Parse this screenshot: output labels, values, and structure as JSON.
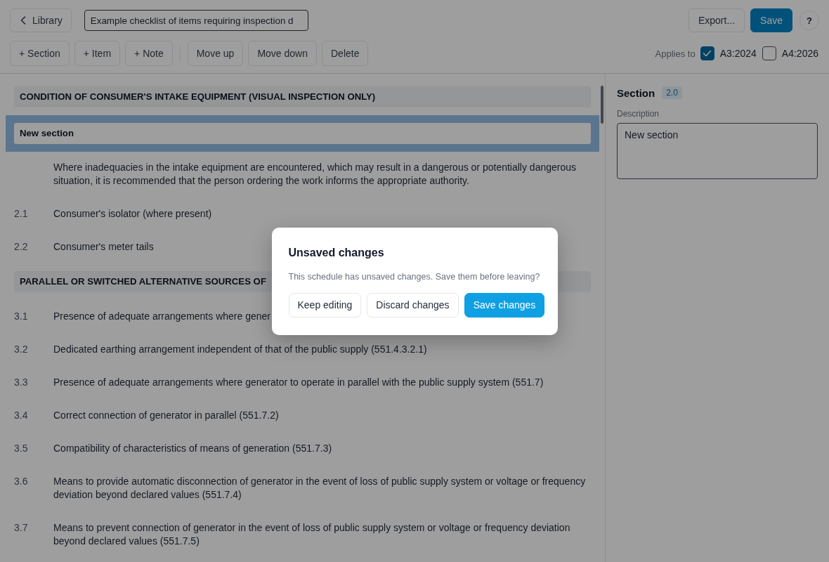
{
  "header": {
    "back_button": "Library",
    "title_field": {
      "value": "Example checklist of items requiring inspection d"
    },
    "export_button": "Export...",
    "save_button": "Save",
    "help_button": "?"
  },
  "toolbar": {
    "insert_buttons": [
      "+ Section",
      "+ Item",
      "+ Note"
    ],
    "edit_buttons": [
      "Move up",
      "Move down",
      "Delete"
    ]
  },
  "applies_to": {
    "label": "Applies to",
    "options": [
      {
        "label": "A3:2024",
        "checked": true
      },
      {
        "label": "A4:2026",
        "checked": false
      }
    ]
  },
  "checklist": {
    "rows": [
      {
        "kind": "heading",
        "text": "CONDITION OF CONSUMER'S INTAKE EQUIPMENT (VISUAL INSPECTION ONLY)",
        "selected": false
      },
      {
        "kind": "heading",
        "text": "New section",
        "selected": true
      },
      {
        "kind": "note",
        "text": "Where inadequacies in the intake equipment are encountered, which may result in a dangerous or potentially dangerous situation, it is recommended that the person ordering the work informs the appropriate authority.",
        "selected": false
      },
      {
        "kind": "item",
        "number": "2.1",
        "text": "Consumer's isolator (where present)",
        "selected": false
      },
      {
        "kind": "item",
        "number": "2.2",
        "text": "Consumer's meter tails",
        "selected": false
      },
      {
        "kind": "heading",
        "text": "PARALLEL OR SWITCHED ALTERNATIVE SOURCES OF",
        "selected": false
      },
      {
        "kind": "item",
        "number": "3.1",
        "text": "Presence of adequate arrangements where gener",
        "selected": false
      },
      {
        "kind": "item",
        "number": "3.2",
        "text": "Dedicated earthing arrangement independent of that of the public supply (551.4.3.2.1)",
        "selected": false
      },
      {
        "kind": "item",
        "number": "3.3",
        "text": "Presence of adequate arrangements where generator to operate in parallel with the public supply system (551.7)",
        "selected": false
      },
      {
        "kind": "item",
        "number": "3.4",
        "text": "Correct connection of generator in parallel (551.7.2)",
        "selected": false
      },
      {
        "kind": "item",
        "number": "3.5",
        "text": "Compatibility of characteristics of means of generation (551.7.3)",
        "selected": false
      },
      {
        "kind": "item",
        "number": "3.6",
        "text": "Means to provide automatic disconnection of generator in the event of loss of public supply system or voltage or frequency deviation beyond declared values (551.7.4)",
        "selected": false
      },
      {
        "kind": "item",
        "number": "3.7",
        "text": "Means to prevent connection of generator in the event of loss of public supply system or voltage or frequency deviation beyond declared values (551.7.5)",
        "selected": false
      }
    ]
  },
  "details": {
    "title": "Section",
    "badge": "2.0",
    "description_label": "Description",
    "description_value": "New section"
  },
  "dialog": {
    "title": "Unsaved changes",
    "message": "This schedule has unsaved changes. Save them before leaving?",
    "buttons": [
      {
        "label": "Keep editing",
        "kind": "secondary"
      },
      {
        "label": "Discard changes",
        "kind": "secondary"
      },
      {
        "label": "Save changes",
        "kind": "primary"
      }
    ]
  }
}
